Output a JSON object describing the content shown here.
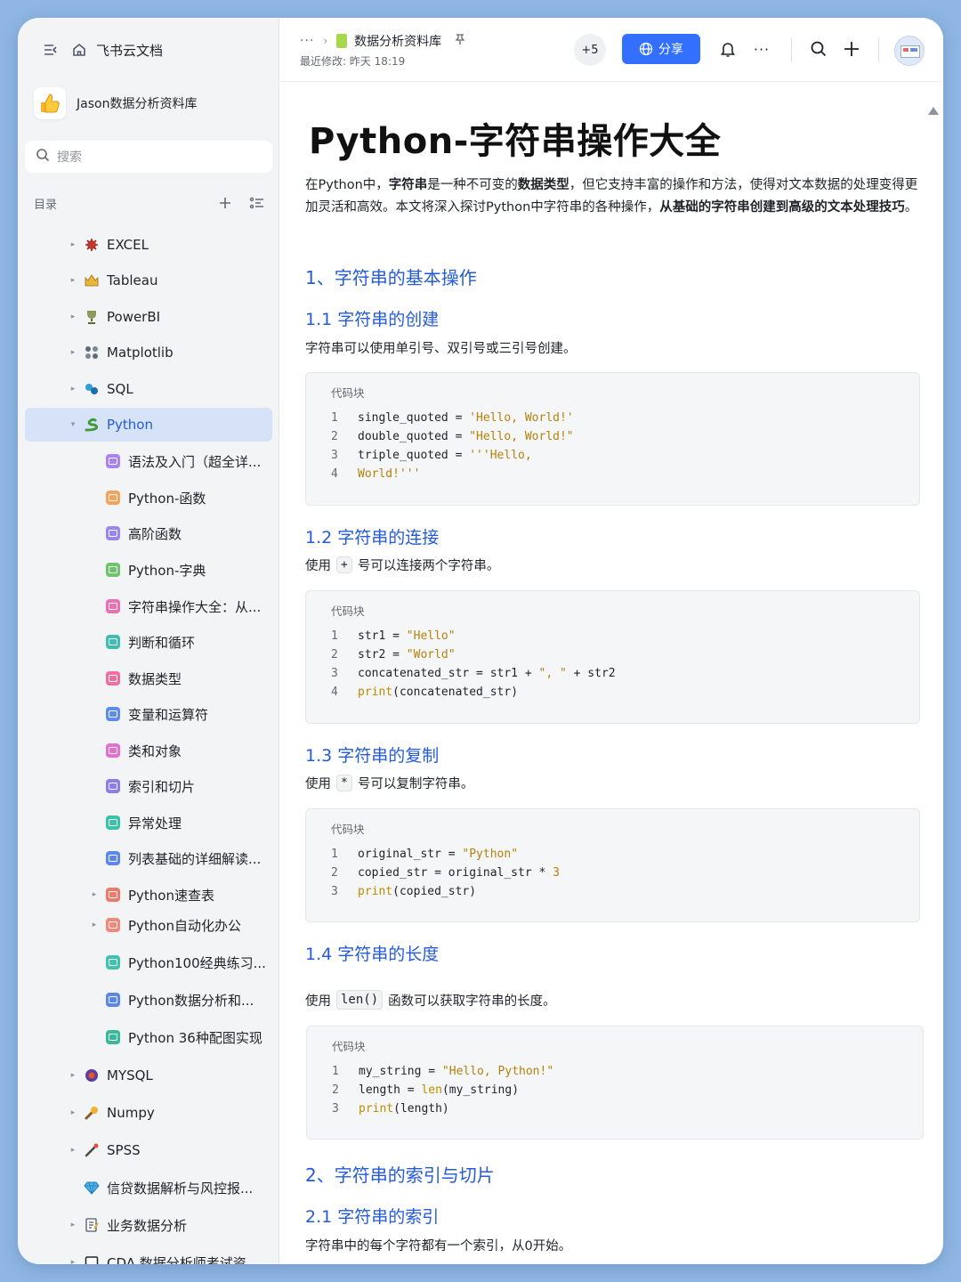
{
  "app": {
    "name": "飞书云文档"
  },
  "space": {
    "name": "Jason数据分析资料库"
  },
  "search": {
    "placeholder": "搜索"
  },
  "toc": {
    "label": "目录"
  },
  "tree": [
    {
      "label": "EXCEL",
      "icon": "excel-emoji-icon",
      "caret": "▸",
      "level": 0
    },
    {
      "label": "Tableau",
      "icon": "tableau-emoji-icon",
      "caret": "▸",
      "level": 0
    },
    {
      "label": "PowerBI",
      "icon": "powerbi-emoji-icon",
      "caret": "▸",
      "level": 0
    },
    {
      "label": "Matplotlib",
      "icon": "matplotlib-emoji-icon",
      "caret": "▸",
      "level": 0
    },
    {
      "label": "SQL",
      "icon": "sql-emoji-icon",
      "caret": "▸",
      "level": 0
    },
    {
      "label": "Python",
      "icon": "python-snake-icon",
      "caret": "▾",
      "level": 0,
      "active": true
    },
    {
      "label": "语法及入门（超全详...",
      "icon": "doc-icon",
      "color": "#a982f5",
      "level": 1
    },
    {
      "label": "Python-函数",
      "icon": "doc-icon",
      "color": "#f5a25b",
      "level": 1
    },
    {
      "label": "高阶函数",
      "icon": "doc-icon",
      "color": "#9a86f0",
      "level": 1
    },
    {
      "label": "Python-字典",
      "icon": "doc-icon",
      "color": "#6cc46c",
      "level": 1
    },
    {
      "label": "字符串操作大全：从...",
      "icon": "doc-icon",
      "color": "#ec6fb4",
      "level": 1
    },
    {
      "label": "判断和循环",
      "icon": "doc-icon",
      "color": "#3fbfb4",
      "level": 1
    },
    {
      "label": "数据类型",
      "icon": "doc-icon",
      "color": "#ef6fa3",
      "level": 1
    },
    {
      "label": "变量和运算符",
      "icon": "doc-icon",
      "color": "#5c8cf0",
      "level": 1
    },
    {
      "label": "类和对象",
      "icon": "doc-icon",
      "color": "#e46fd0",
      "level": 1
    },
    {
      "label": "索引和切片",
      "icon": "doc-icon",
      "color": "#8f7bf0",
      "level": 1
    },
    {
      "label": "异常处理",
      "icon": "doc-icon",
      "color": "#38c3a7",
      "level": 1
    },
    {
      "label": "列表基础的详细解读...",
      "icon": "doc-icon",
      "color": "#5b86ec",
      "level": 1
    },
    {
      "label": "Python速查表",
      "icon": "doc-icon",
      "color": "#f07a6a",
      "caret": "▸",
      "level": 1
    },
    {
      "label": "Python自动化办公",
      "icon": "doc-icon",
      "color": "#f2877a",
      "caret": "▸",
      "level": 1
    },
    {
      "label": "Python100经典练习...",
      "icon": "doc-icon",
      "color": "#3fc2b0",
      "level": 1
    },
    {
      "label": "Python数据分析和...",
      "icon": "doc-icon",
      "color": "#5b86ec",
      "level": 1
    },
    {
      "label": "Python 36种配图实现",
      "icon": "doc-icon",
      "color": "#38b99a",
      "level": 1
    },
    {
      "label": "MYSQL",
      "icon": "mysql-emoji-icon",
      "caret": "▸",
      "level": 0
    },
    {
      "label": "Numpy",
      "icon": "numpy-emoji-icon",
      "caret": "▸",
      "level": 0
    },
    {
      "label": "SPSS",
      "icon": "spss-emoji-icon",
      "caret": "▸",
      "level": 0
    },
    {
      "label": "信贷数据解析与风控报...",
      "icon": "diamond-icon",
      "level": 0
    },
    {
      "label": "业务数据分析",
      "icon": "memo-icon",
      "caret": "▸",
      "level": 0
    },
    {
      "label": "CDA 数据分析师考试资...",
      "icon": "square-icon",
      "caret": "▸",
      "level": 0
    }
  ],
  "topbar": {
    "more": "···",
    "crumb_sep": "›",
    "crumb": "数据分析资料库",
    "last_modified": "最近修改: 昨天 18:19",
    "collaborators": "+5",
    "share_label": "分享",
    "more_menu": "···"
  },
  "doc": {
    "title": "Python-字符串操作大全",
    "intro": [
      {
        "t": "在Python中，",
        "b": false
      },
      {
        "t": "字符串",
        "b": true
      },
      {
        "t": "是一种不可变的",
        "b": false
      },
      {
        "t": "数据类型",
        "b": true
      },
      {
        "t": "，但它支持丰富的操作和方法，使得对文本数据的处理变得更加灵活和高效。本文将深入探讨Python中字符串的各种操作，",
        "b": false
      },
      {
        "t": "从基础的字符串创建到高级的文本处理技巧",
        "b": true
      },
      {
        "t": "。",
        "b": false
      }
    ],
    "code_label": "代码块",
    "h_basic": "1、字符串的基本操作",
    "h_create": "1.1 字符串的创建",
    "p_create": "字符串可以使用单引号、双引号或三引号创建。",
    "h_concat": "1.2 字符串的连接",
    "p_concat_pre": "使用",
    "p_concat_code": "+",
    "p_concat_post": "号可以连接两个字符串。",
    "h_copy": "1.3 字符串的复制",
    "p_copy_pre": "使用",
    "p_copy_code": "*",
    "p_copy_post": "号可以复制字符串。",
    "h_len": "1.4 字符串的长度",
    "p_len_pre": "使用",
    "p_len_code": "len()",
    "p_len_post": "函数可以获取字符串的长度。",
    "h_index_slice": "2、字符串的索引与切片",
    "h_index": "2.1 字符串的索引",
    "p_index": "字符串中的每个字符都有一个索引，从0开始。",
    "code_create": [
      [
        [
          "p",
          "single_quoted = "
        ],
        [
          "s",
          "'Hello, World!'"
        ]
      ],
      [
        [
          "p",
          "double_quoted = "
        ],
        [
          "s",
          "\"Hello, World!\""
        ]
      ],
      [
        [
          "p",
          "triple_quoted = "
        ],
        [
          "s",
          "'''Hello,"
        ]
      ],
      [
        [
          "s",
          "World!'''"
        ]
      ]
    ],
    "code_concat": [
      [
        [
          "p",
          "str1 = "
        ],
        [
          "s",
          "\"Hello\""
        ]
      ],
      [
        [
          "p",
          "str2 = "
        ],
        [
          "s",
          "\"World\""
        ]
      ],
      [
        [
          "p",
          "concatenated_str = str1 + "
        ],
        [
          "s",
          "\", \""
        ],
        [
          "p",
          " + str2"
        ]
      ],
      [
        [
          "f",
          "print"
        ],
        [
          "p",
          "(concatenated_str)"
        ]
      ]
    ],
    "code_copy": [
      [
        [
          "p",
          "original_str = "
        ],
        [
          "s",
          "\"Python\""
        ]
      ],
      [
        [
          "p",
          "copied_str = original_str * "
        ],
        [
          "n",
          "3"
        ]
      ],
      [
        [
          "f",
          "print"
        ],
        [
          "p",
          "(copied_str)"
        ]
      ]
    ],
    "code_len": [
      [
        [
          "p",
          "my_string = "
        ],
        [
          "s",
          "\"Hello, Python!\""
        ]
      ],
      [
        [
          "p",
          "length = "
        ],
        [
          "f",
          "len"
        ],
        [
          "p",
          "(my_string)"
        ]
      ],
      [
        [
          "f",
          "print"
        ],
        [
          "p",
          "(length)"
        ]
      ]
    ]
  },
  "colors": {
    "accent": "#3370ff",
    "heading": "#245bdb",
    "active_bg": "#d6e2f7",
    "page_bg": "#8fb6e4"
  }
}
